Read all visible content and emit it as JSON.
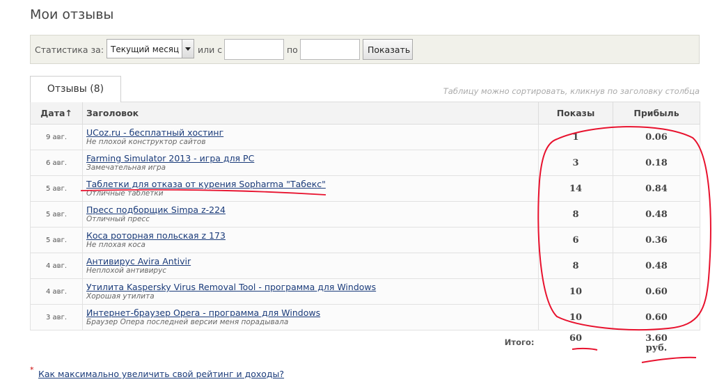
{
  "page": {
    "title": "Мои отзывы"
  },
  "filter": {
    "label_stats": "Статистика за:",
    "period_selected": "Текущий месяц",
    "label_from": "или с",
    "label_to": "по",
    "from_value": "",
    "to_value": "",
    "show_button": "Показать"
  },
  "tabs": {
    "reviews_label": "Отзывы (8)"
  },
  "hint": "Таблицу можно сортировать, кликнув по заголовку столбца",
  "table": {
    "headers": {
      "date": "Дата↑",
      "title": "Заголовок",
      "views": "Показы",
      "profit": "Прибыль"
    },
    "rows": [
      {
        "date": "9 авг.",
        "title": "UCoz.ru - бесплатный хостинг",
        "subtitle": "Не плохой конструктор сайтов",
        "views": "1",
        "profit": "0.06"
      },
      {
        "date": "6 авг.",
        "title": "Farming Simulator 2013 - игра для PC",
        "subtitle": "Замечательная игра",
        "views": "3",
        "profit": "0.18"
      },
      {
        "date": "5 авг.",
        "title": "Таблетки для отказа от курения Sopharma \"Табекс\"",
        "subtitle": "Отличные таблетки",
        "views": "14",
        "profit": "0.84"
      },
      {
        "date": "5 авг.",
        "title": "Пресс подборщик Simpa z-224",
        "subtitle": "Отличный пресс",
        "views": "8",
        "profit": "0.48"
      },
      {
        "date": "5 авг.",
        "title": "Коса роторная польская z 173",
        "subtitle": "Не плохая коса",
        "views": "6",
        "profit": "0.36"
      },
      {
        "date": "4 авг.",
        "title": "Антивирус Avira Antivir",
        "subtitle": "Неплохой антивирус",
        "views": "8",
        "profit": "0.48"
      },
      {
        "date": "4 авг.",
        "title": "Утилита Kaspersky Virus Removal Tool - программа для Windows",
        "subtitle": "Хорошая утилита",
        "views": "10",
        "profit": "0.60"
      },
      {
        "date": "3 авг.",
        "title": "Интернет-браузер Opera - программа для Windows",
        "subtitle": "Браузер Опера последней версии меня порадывала",
        "views": "10",
        "profit": "0.60"
      }
    ],
    "totals": {
      "label": "Итого:",
      "views": "60",
      "profit": "3.60",
      "currency": "руб."
    }
  },
  "footer": {
    "star": "*",
    "link": "Как максимально увеличить свой рейтинг и доходы?"
  },
  "colors": {
    "link": "#1a3b7a",
    "annotation": "#e8112d",
    "filter_bg": "#f1f1ea"
  }
}
